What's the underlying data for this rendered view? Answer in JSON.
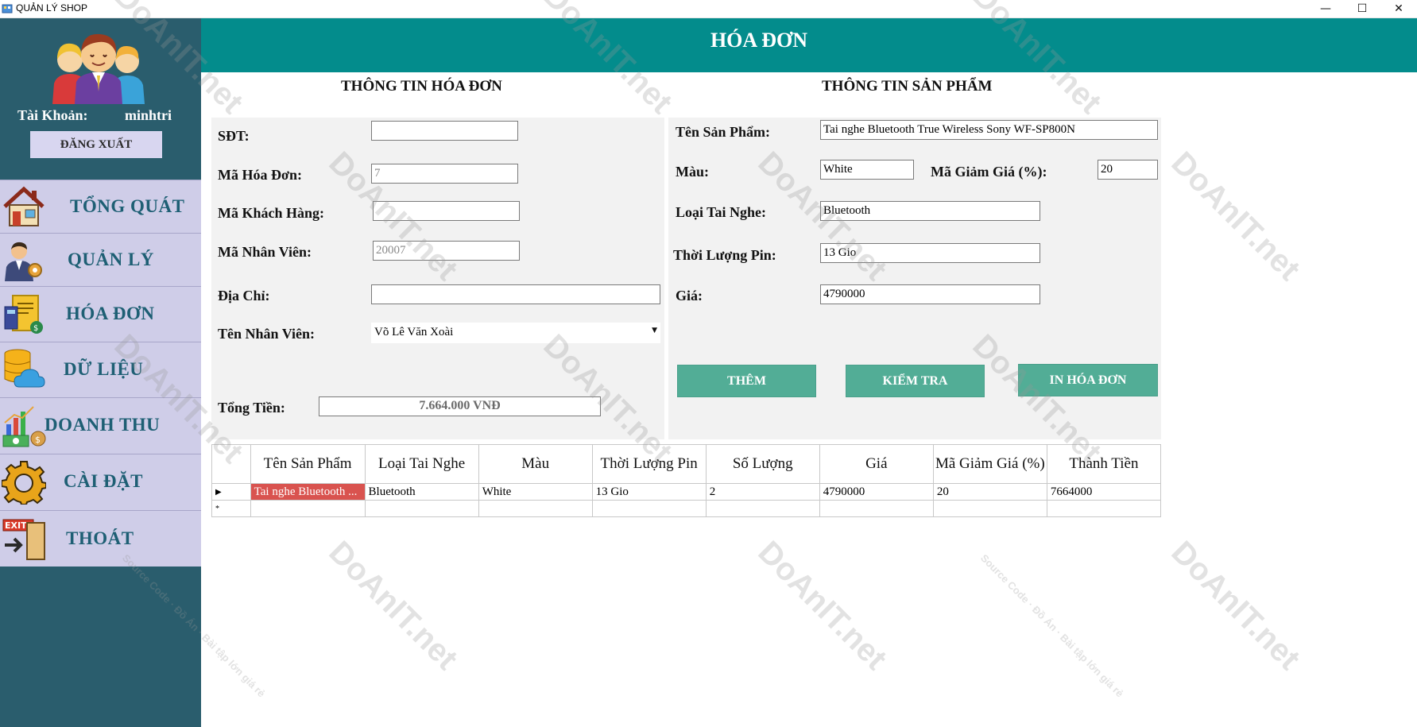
{
  "window": {
    "title": "QUẢN LÝ SHOP",
    "minimize": "—",
    "maximize": "☐",
    "close": "✕"
  },
  "sidebar": {
    "account_label": "Tài Khoản:",
    "account_value": "minhtri",
    "logout_label": "ĐĂNG XUẤT",
    "items": [
      {
        "label": "TỔNG QUÁT",
        "icon": "house-icon"
      },
      {
        "label": "QUẢN LÝ",
        "icon": "manager-icon"
      },
      {
        "label": "HÓA ĐƠN",
        "icon": "invoice-icon"
      },
      {
        "label": "DỮ LIỆU",
        "icon": "database-cloud-icon"
      },
      {
        "label": "DOANH THU",
        "icon": "revenue-chart-icon"
      },
      {
        "label": "CÀI ĐẶT",
        "icon": "gear-icon"
      },
      {
        "label": "THOÁT",
        "icon": "exit-icon"
      }
    ]
  },
  "header": {
    "title": "HÓA ĐƠN"
  },
  "invoice": {
    "section_title": "THÔNG TIN HÓA ĐƠN",
    "phone_label": "SĐT:",
    "phone_value": "",
    "invoice_id_label": "Mã Hóa Đơn:",
    "invoice_id_value": "7",
    "customer_id_label": "Mã Khách Hàng:",
    "customer_id_value": "",
    "employee_id_label": "Mã Nhân Viên:",
    "employee_id_value": "20007",
    "address_label": "Địa Chỉ:",
    "address_value": "",
    "employee_name_label": "Tên Nhân Viên:",
    "employee_name_value": "Võ Lê Văn Xoài",
    "total_label": "Tổng Tiền:",
    "total_value": "7.664.000  VNĐ"
  },
  "product": {
    "section_title": "THÔNG TIN SẢN PHẨM",
    "name_label": "Tên Sản Phẩm:",
    "name_value": "Tai nghe Bluetooth True Wireless Sony WF-SP800N",
    "color_label": "Màu:",
    "color_value": "White",
    "discount_label": "Mã Giảm Giá (%):",
    "discount_value": "20",
    "type_label": "Loại Tai Nghe:",
    "type_value": "Bluetooth",
    "battery_label": "Thời Lượng Pin:",
    "battery_value": "13 Gio",
    "price_label": "Giá:",
    "price_value": "4790000",
    "add_button": "THÊM",
    "check_button": "KIỂM TRA",
    "print_button": "IN HÓA ĐƠN"
  },
  "table": {
    "columns": [
      "Tên Sản Phẩm",
      "Loại Tai Nghe",
      "Màu",
      "Thời Lượng Pin",
      "Số Lượng",
      "Giá",
      "Mã Giảm Giá (%)",
      "Thành Tiền"
    ],
    "rows": [
      [
        "Tai nghe Bluetooth ...",
        "Bluetooth",
        "White",
        "13 Gio",
        "2",
        "4790000",
        "20",
        "7664000"
      ]
    ],
    "current_row_marker": "▶",
    "new_row_marker": "*"
  },
  "watermark": {
    "brand": "DoAnIT.net",
    "tagline": "Source Code · Đồ Án · Bài tập lớn giá rẻ"
  },
  "colors": {
    "sidebar": "#2a5d6d",
    "menu": "#cfcde8",
    "header": "#038c8c",
    "button": "#52ad96",
    "selected_cell": "#d9534f"
  }
}
